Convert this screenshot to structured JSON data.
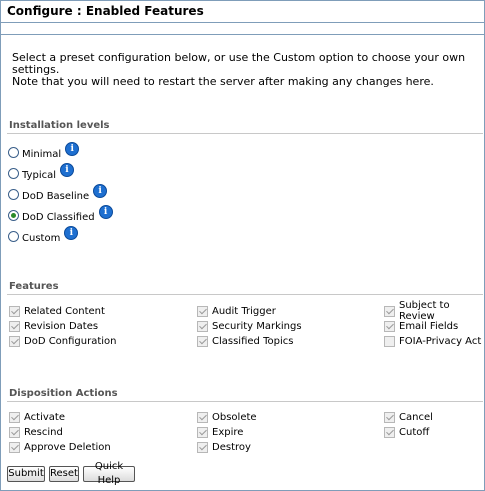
{
  "header": {
    "title": "Configure : Enabled Features"
  },
  "intro": {
    "line1": "Select a preset configuration below, or use the Custom option to choose your own settings.",
    "line2": "Note that you will need to restart the server after making any changes here."
  },
  "installation": {
    "heading": "Installation levels",
    "options": [
      {
        "label": "Minimal",
        "checked": false
      },
      {
        "label": "Typical",
        "checked": false
      },
      {
        "label": "DoD Baseline",
        "checked": false
      },
      {
        "label": "DoD Classified",
        "checked": true
      },
      {
        "label": "Custom",
        "checked": false
      }
    ],
    "info_glyph": "i"
  },
  "features": {
    "heading": "Features",
    "col1": [
      {
        "label": "Related Content",
        "checked": true
      },
      {
        "label": "Revision Dates",
        "checked": true
      },
      {
        "label": "DoD Configuration",
        "checked": true
      }
    ],
    "col2": [
      {
        "label": "Audit Trigger",
        "checked": true
      },
      {
        "label": "Security Markings",
        "checked": true
      },
      {
        "label": "Classified Topics",
        "checked": true
      }
    ],
    "col3": [
      {
        "label": "Subject to Review",
        "checked": true
      },
      {
        "label": "Email Fields",
        "checked": true
      },
      {
        "label": "FOIA-Privacy Act",
        "checked": false
      }
    ]
  },
  "disposition": {
    "heading": "Disposition Actions",
    "col1": [
      {
        "label": "Activate",
        "checked": true
      },
      {
        "label": "Rescind",
        "checked": true
      },
      {
        "label": "Approve Deletion",
        "checked": true
      }
    ],
    "col2": [
      {
        "label": "Obsolete",
        "checked": true
      },
      {
        "label": "Expire",
        "checked": true
      },
      {
        "label": "Destroy",
        "checked": true
      }
    ],
    "col3": [
      {
        "label": "Cancel",
        "checked": true
      },
      {
        "label": "Cutoff",
        "checked": true
      }
    ]
  },
  "buttons": {
    "submit": "Submit",
    "reset": "Reset",
    "help": "Quick Help"
  }
}
